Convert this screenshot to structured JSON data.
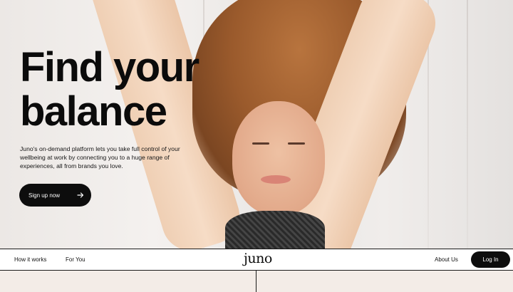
{
  "hero": {
    "headline": "Find your\nbalance",
    "subtext": "Juno's on-demand platform lets you take full control of your wellbeing at work by connecting you to a huge range of experiences, all from brands you love.",
    "cta_label": "Sign up now",
    "cta_icon": "arrow-right-icon"
  },
  "nav": {
    "how_it_works": "How it works",
    "for_you": "For You",
    "logo": "juno",
    "about_us": "About Us",
    "log_in": "Log In"
  },
  "colors": {
    "primary_button": "#0d0d0d",
    "button_text": "#ffffff",
    "page_background": "#f3ece7"
  }
}
